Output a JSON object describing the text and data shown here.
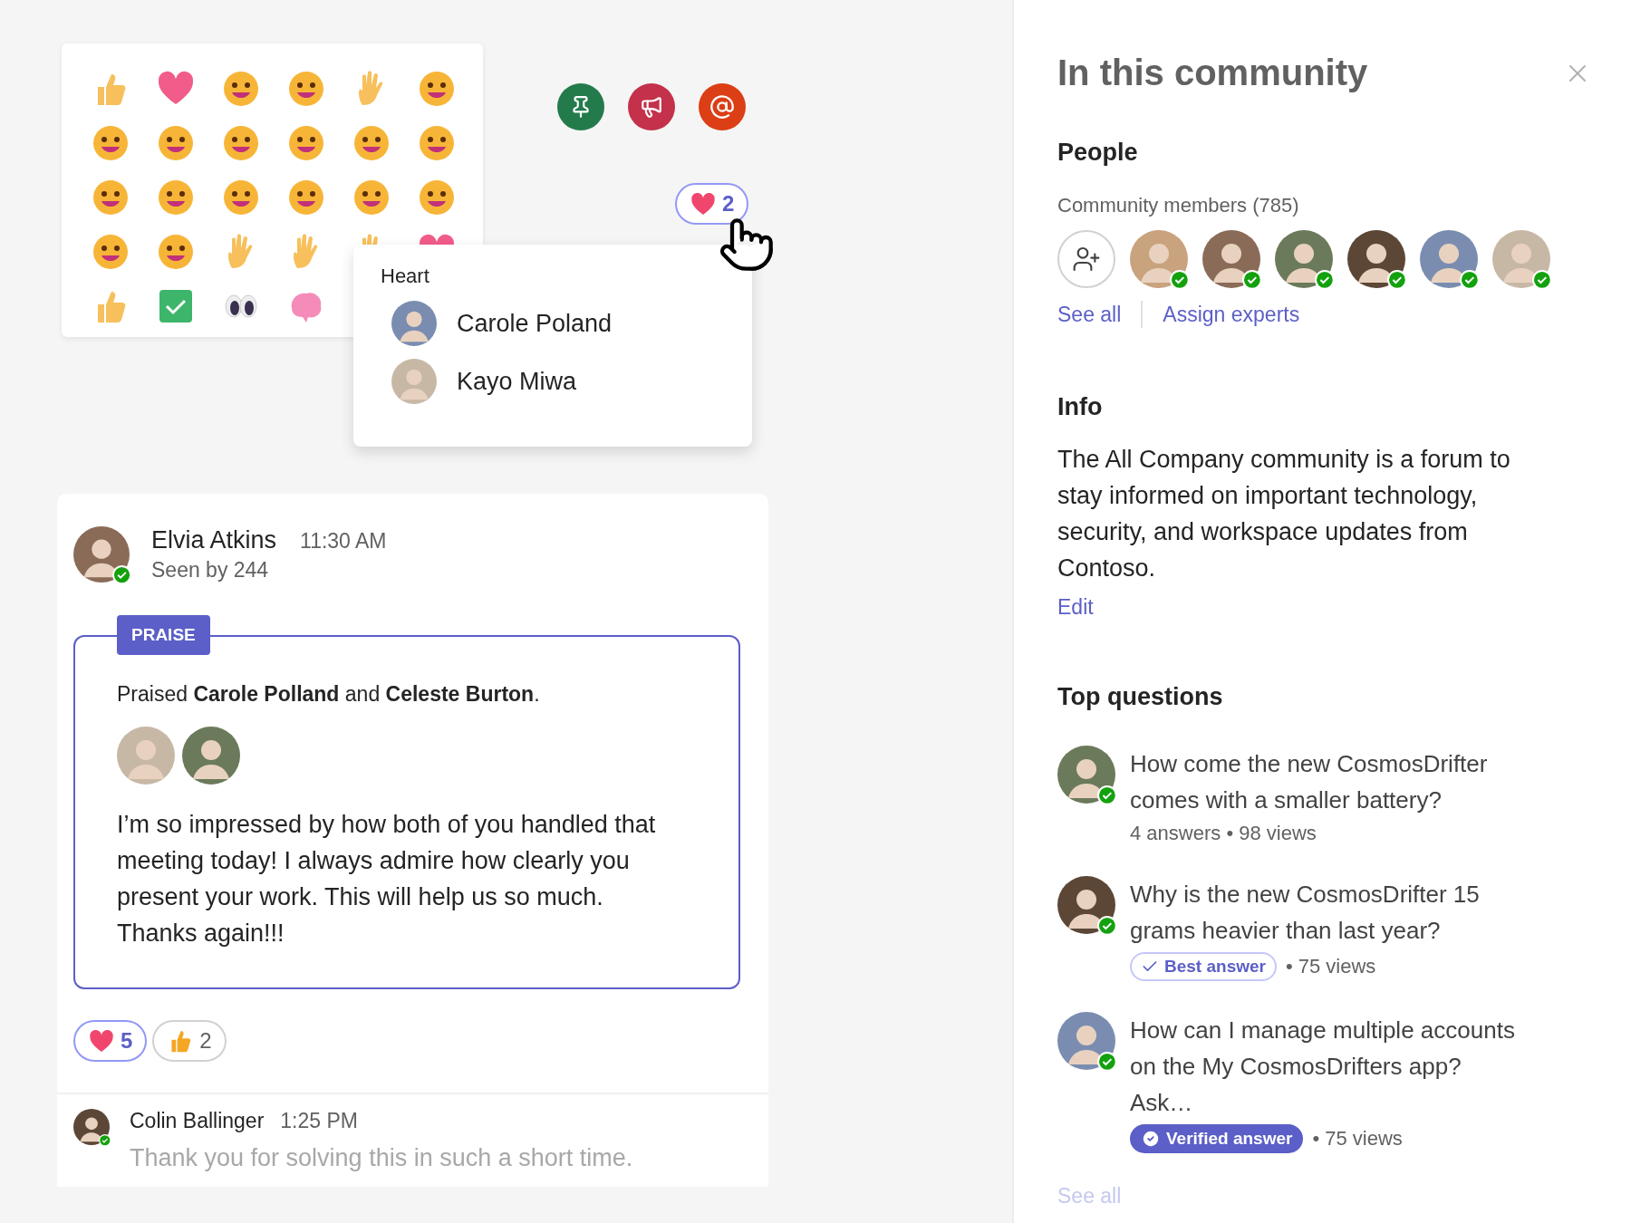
{
  "reaction_popup": {
    "badge": {
      "count": "2",
      "selected": true
    },
    "title": "Heart",
    "people": [
      {
        "name": "Carole Poland"
      },
      {
        "name": "Kayo Miwa"
      }
    ]
  },
  "message": {
    "author": "Elvia Atkins",
    "time": "11:30 AM",
    "seen": "Seen by 244",
    "tag": "PRAISE",
    "praised": "Praised **Carole Polland** and **Celeste Burton**.",
    "body": "I’m so impressed by how both of you handled that meeting today! I always admire how clearly you present your work. This will help us so much. Thanks again!!!",
    "reactions": [
      {
        "kind": "heart",
        "count": "5",
        "selected": true
      },
      {
        "kind": "thumbs",
        "count": "2",
        "selected": false
      }
    ]
  },
  "reply": {
    "author": "Colin Ballinger",
    "time": "1:25 PM",
    "text": "Thank you for solving this in such a short time."
  },
  "panel": {
    "title": "In this community",
    "people": {
      "heading": "People",
      "members_label": "Community members (785)",
      "links": [
        "See all",
        "Assign experts"
      ]
    },
    "info": {
      "heading": "Info",
      "text": "The All Company community is a forum to stay informed on important technology, security, and workspace updates from Contoso.",
      "edit": "Edit"
    },
    "top_questions": {
      "heading": "Top questions",
      "items": [
        {
          "question": "How come the new CosmosDrifter comes with a smaller battery?",
          "meta": "4 answers • 98 views"
        },
        {
          "question": "Why is the new CosmosDrifter 15 grams heavier than last year?",
          "badge": {
            "kind": "best",
            "label": "Best answer"
          },
          "meta": "• 75 views"
        },
        {
          "question": "How can I manage multiple accounts on the My CosmosDrifters app? Ask…",
          "badge": {
            "kind": "verified",
            "label": "Verified answer"
          },
          "meta": "• 75 views"
        }
      ],
      "see_all": "See all"
    }
  }
}
